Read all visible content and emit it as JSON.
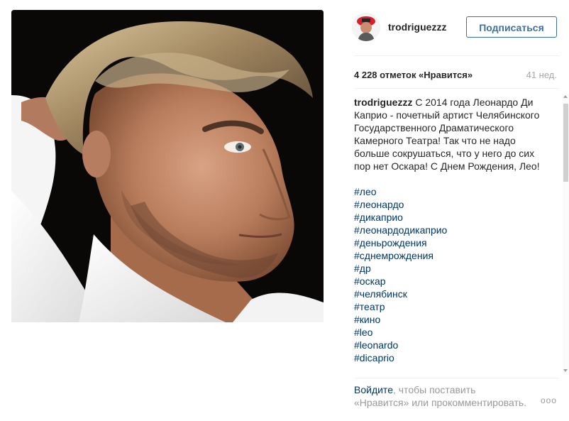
{
  "profile": {
    "username": "trodriguezzz",
    "follow_label": "Подписаться"
  },
  "post": {
    "likes": "4 228 отметок «Нравится»",
    "time_ago": "41 нед.",
    "caption_author": "trodriguezzz",
    "caption_text": "С 2014 года Леонардо Ди Каприо - почетный артист Челябинского Государственного Драматического Камерного Театра! Так что не надо больше сокрушаться, что у него до сих пор нет Оскара! С Днем Рождения, Лео!",
    "hashtags": [
      "#лео",
      "#леонардо",
      "#дикаприо",
      "#леонардодикаприо",
      "#деньрождения",
      "#сднемрождения",
      "#др",
      "#оскар",
      "#челябинск",
      "#театр",
      "#кино",
      "#leo",
      "#leonardo",
      "#dicaprio"
    ]
  },
  "footer": {
    "login_label": "Войдите",
    "text_after_login": ", чтобы поставить «Нравится» или прокомментировать.",
    "more_label": "ооо"
  },
  "icons": {
    "more": "more-options-icon",
    "scroll_up": "scroll-up-icon",
    "scroll_down": "scroll-down-icon"
  }
}
